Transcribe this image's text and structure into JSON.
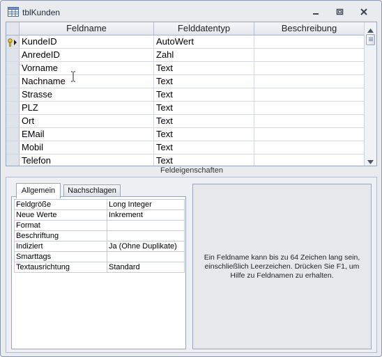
{
  "window": {
    "title": "tblKunden",
    "icons": {
      "table": "table-icon",
      "minimize": "minimize-icon",
      "restore": "restore-icon",
      "close": "close-icon"
    }
  },
  "grid": {
    "columns": [
      "Feldname",
      "Felddatentyp",
      "Beschreibung"
    ],
    "rows": [
      {
        "name": "KundeID",
        "type": "AutoWert",
        "description": "",
        "primary_key": true,
        "current": true
      },
      {
        "name": "AnredeID",
        "type": "Zahl",
        "description": ""
      },
      {
        "name": "Vorname",
        "type": "Text",
        "description": ""
      },
      {
        "name": "Nachname",
        "type": "Text",
        "description": ""
      },
      {
        "name": "Strasse",
        "type": "Text",
        "description": ""
      },
      {
        "name": "PLZ",
        "type": "Text",
        "description": ""
      },
      {
        "name": "Ort",
        "type": "Text",
        "description": ""
      },
      {
        "name": "EMail",
        "type": "Text",
        "description": ""
      },
      {
        "name": "Mobil",
        "type": "Text",
        "description": ""
      },
      {
        "name": "Telefon",
        "type": "Text",
        "description": ""
      }
    ]
  },
  "section_label": "Feldeigenschaften",
  "tabs": {
    "general": "Allgemein",
    "lookup": "Nachschlagen"
  },
  "properties": [
    {
      "name": "Feldgröße",
      "value": "Long Integer"
    },
    {
      "name": "Neue Werte",
      "value": "Inkrement"
    },
    {
      "name": "Format",
      "value": ""
    },
    {
      "name": "Beschriftung",
      "value": ""
    },
    {
      "name": "Indiziert",
      "value": "Ja (Ohne Duplikate)"
    },
    {
      "name": "Smarttags",
      "value": ""
    },
    {
      "name": "Textausrichtung",
      "value": "Standard"
    }
  ],
  "help_text": "Ein Feldname kann bis zu 64 Zeichen lang sein, einschließlich Leerzeichen. Drücken Sie F1, um Hilfe zu Feldnamen zu erhalten.",
  "colors": {
    "titlebar_bg": "#e9ebee",
    "grid_line": "#d4d9e1",
    "border": "#9aa5b5"
  }
}
